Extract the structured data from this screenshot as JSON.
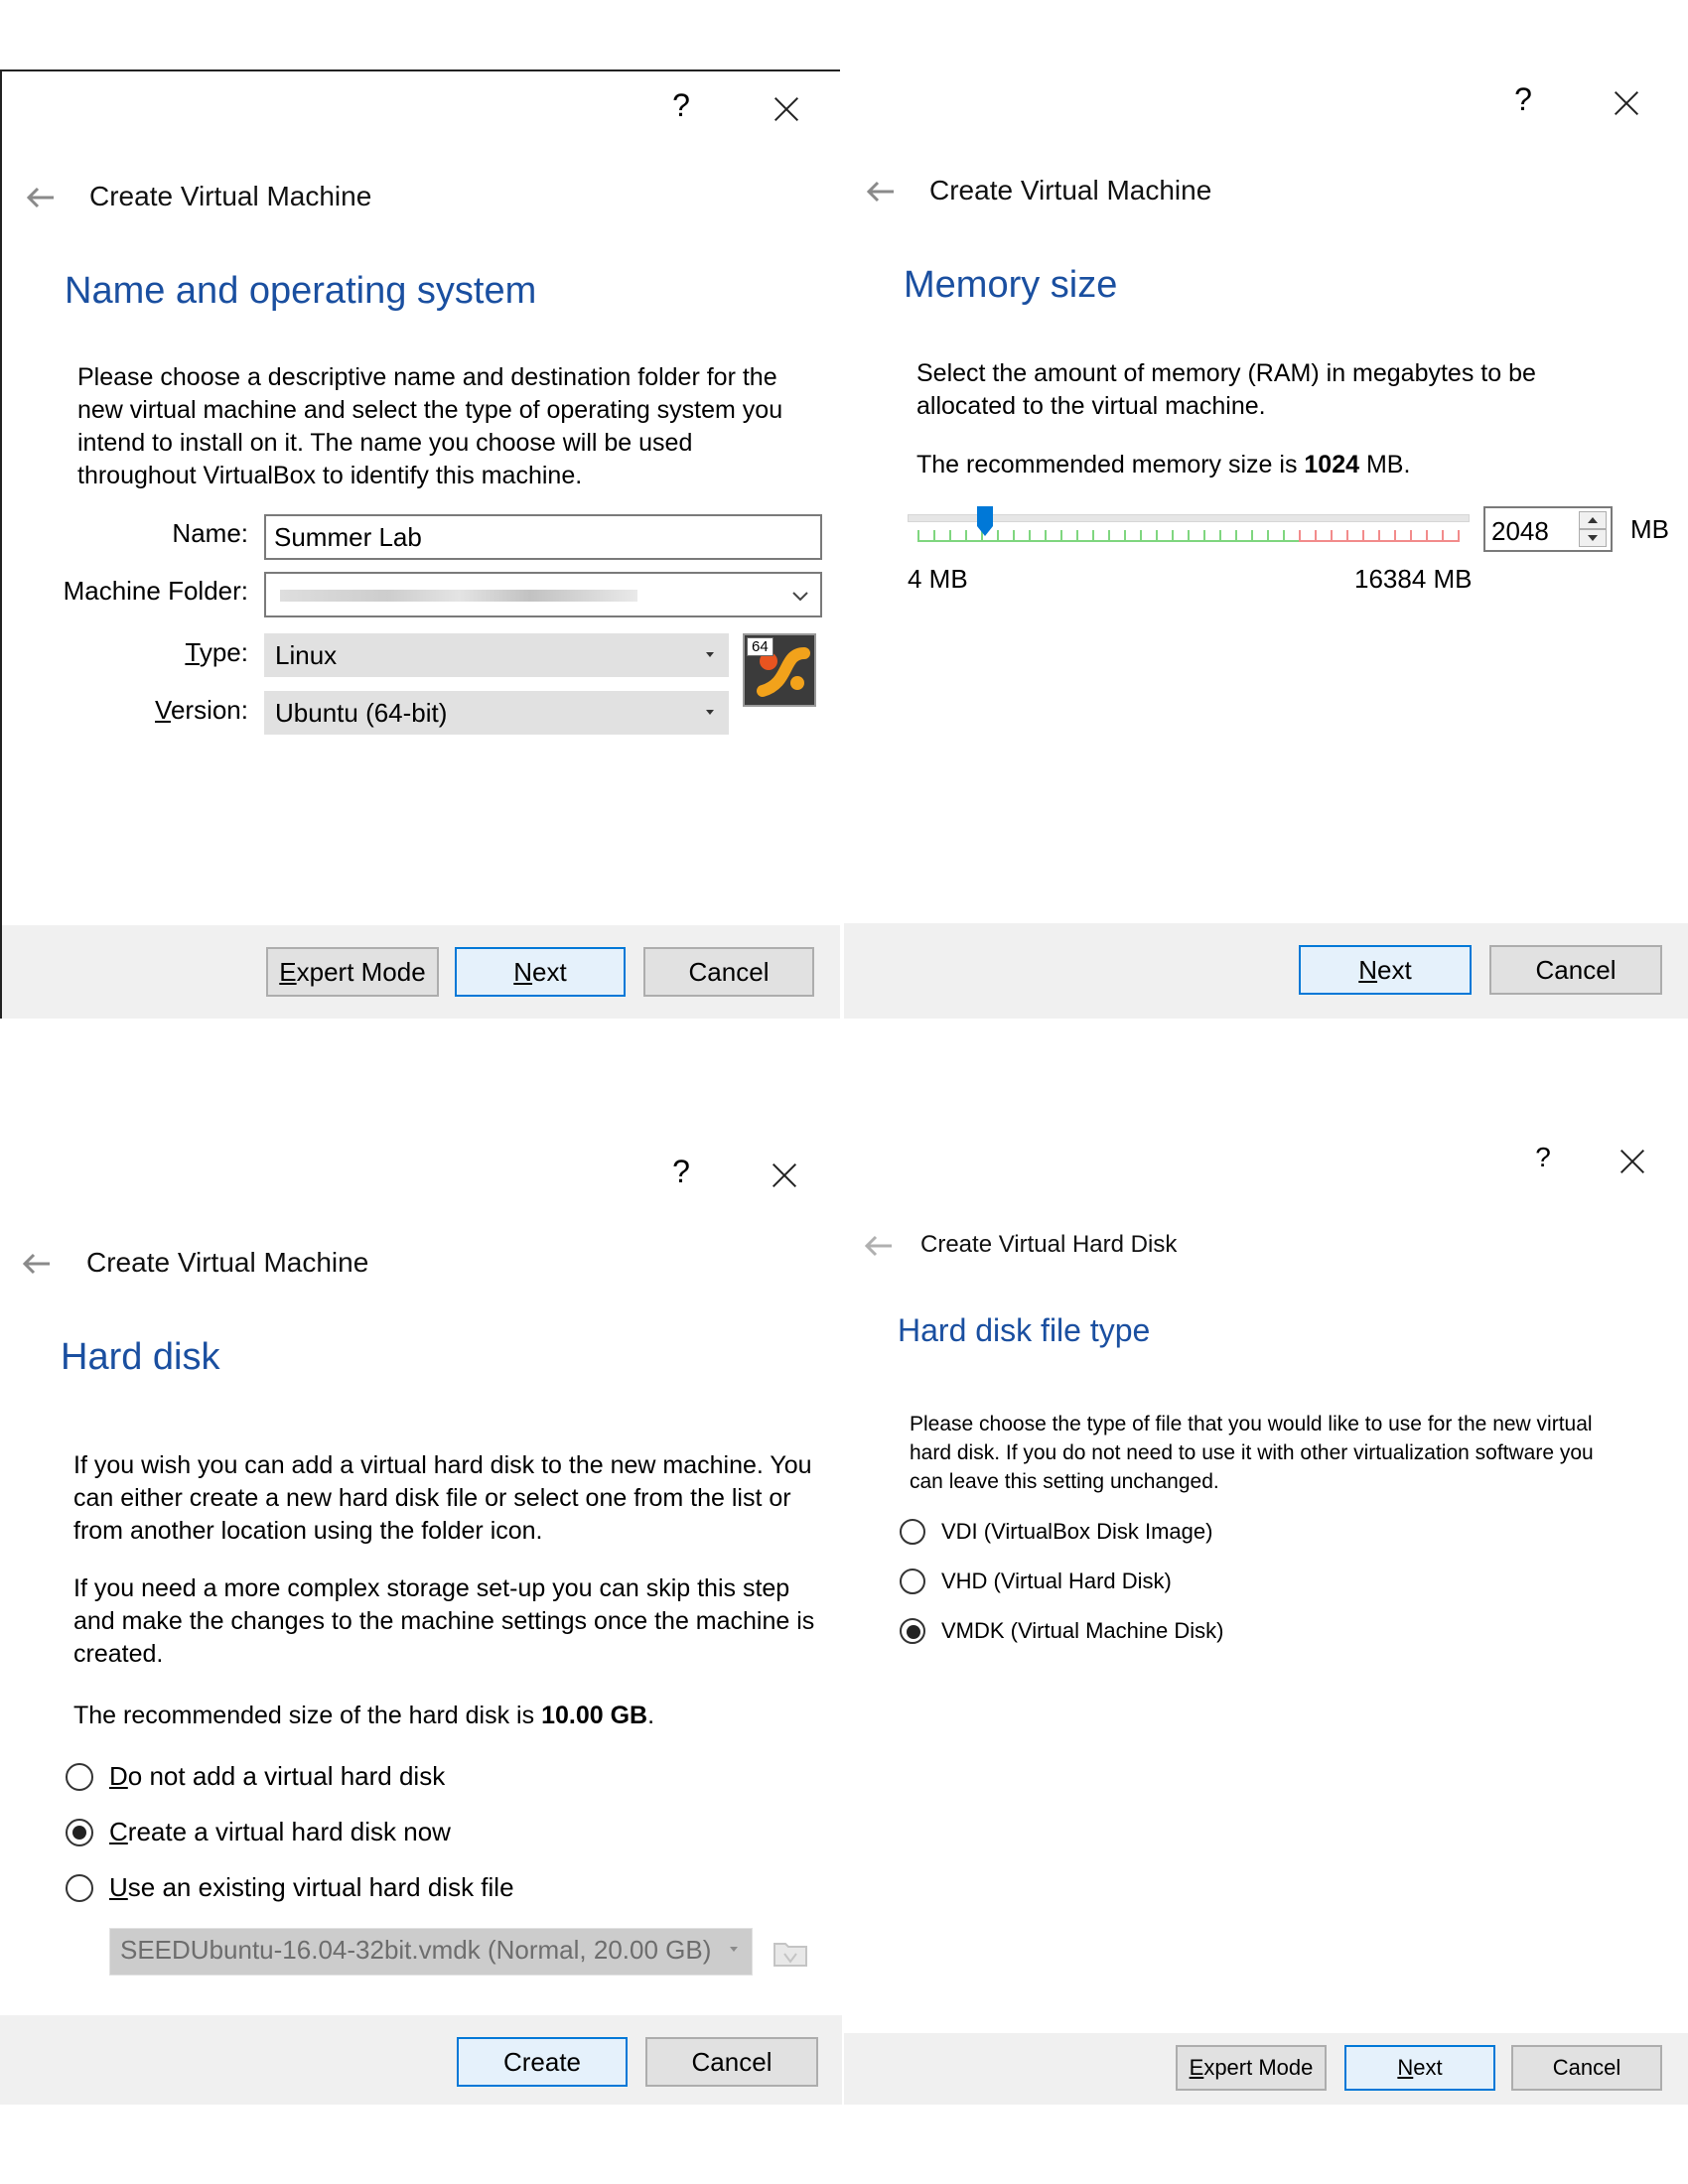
{
  "common": {
    "help_glyph": "?",
    "window_title": "Create Virtual Machine"
  },
  "name_os": {
    "heading": "Name and operating system",
    "description": "Please choose a descriptive name and destination folder for the new virtual machine and select the type of operating system you intend to install on it. The name you choose will be used throughout VirtualBox to identify this machine.",
    "name_label": "Name:",
    "name_value": "Summer Lab",
    "folder_label": "Machine Folder:",
    "type_label_pre": "",
    "type_label_key": "T",
    "type_label_post": "ype:",
    "type_value": "Linux",
    "version_label_key": "V",
    "version_label_post": "ersion:",
    "version_value": "Ubuntu (64-bit)",
    "os_badge": "64",
    "buttons": {
      "expert_key": "E",
      "expert_rest": "xpert Mode",
      "next_key": "N",
      "next_rest": "ext",
      "cancel": "Cancel"
    }
  },
  "memory": {
    "heading": "Memory size",
    "description": "Select the amount of memory (RAM) in megabytes to be allocated to the virtual machine.",
    "recommended_pre": "The recommended memory size is ",
    "recommended_value": "1024",
    "recommended_post": " MB.",
    "slider_min_label": "4 MB",
    "slider_max_label": "16384 MB",
    "slider_min": 4,
    "slider_max": 16384,
    "slider_value": 2048,
    "spin_value": "2048",
    "unit": "MB",
    "buttons": {
      "next_key": "N",
      "next_rest": "ext",
      "cancel": "Cancel"
    }
  },
  "hard_disk": {
    "heading": "Hard disk",
    "description_1": "If you wish you can add a virtual hard disk to the new machine. You can either create a new hard disk file or select one from the list or from another location using the folder icon.",
    "description_2": "If you need a more complex storage set-up you can skip this step and make the changes to the machine settings once the machine is created.",
    "recommended_pre": "The recommended size of the hard disk is ",
    "recommended_value": "10.00 GB",
    "recommended_post": ".",
    "options": [
      {
        "key": "D",
        "rest": "o not add a virtual hard disk",
        "checked": false
      },
      {
        "key": "C",
        "rest": "reate a virtual hard disk now",
        "checked": true
      },
      {
        "key": "U",
        "rest": "se an existing virtual hard disk file",
        "checked": false
      }
    ],
    "existing_file": "SEEDUbuntu-16.04-32bit.vmdk (Normal, 20.00 GB)",
    "buttons": {
      "create": "Create",
      "cancel": "Cancel"
    }
  },
  "disk_type": {
    "window_title": "Create Virtual Hard Disk",
    "heading": "Hard disk file type",
    "description": "Please choose the type of file that you would like to use for the new virtual hard disk. If you do not need to use it with other virtualization software you can leave this setting unchanged.",
    "options": [
      {
        "label": "VDI (VirtualBox Disk Image)",
        "checked": false
      },
      {
        "label": "VHD (Virtual Hard Disk)",
        "checked": false
      },
      {
        "label": "VMDK (Virtual Machine Disk)",
        "checked": true
      }
    ],
    "buttons": {
      "expert_key": "E",
      "expert_rest": "xpert Mode",
      "next_key": "N",
      "next_rest": "ext",
      "cancel": "Cancel"
    }
  },
  "colors": {
    "heading_blue": "#1a4fa0",
    "accent": "#0078d7",
    "footer_bg": "#f0f0f0"
  }
}
